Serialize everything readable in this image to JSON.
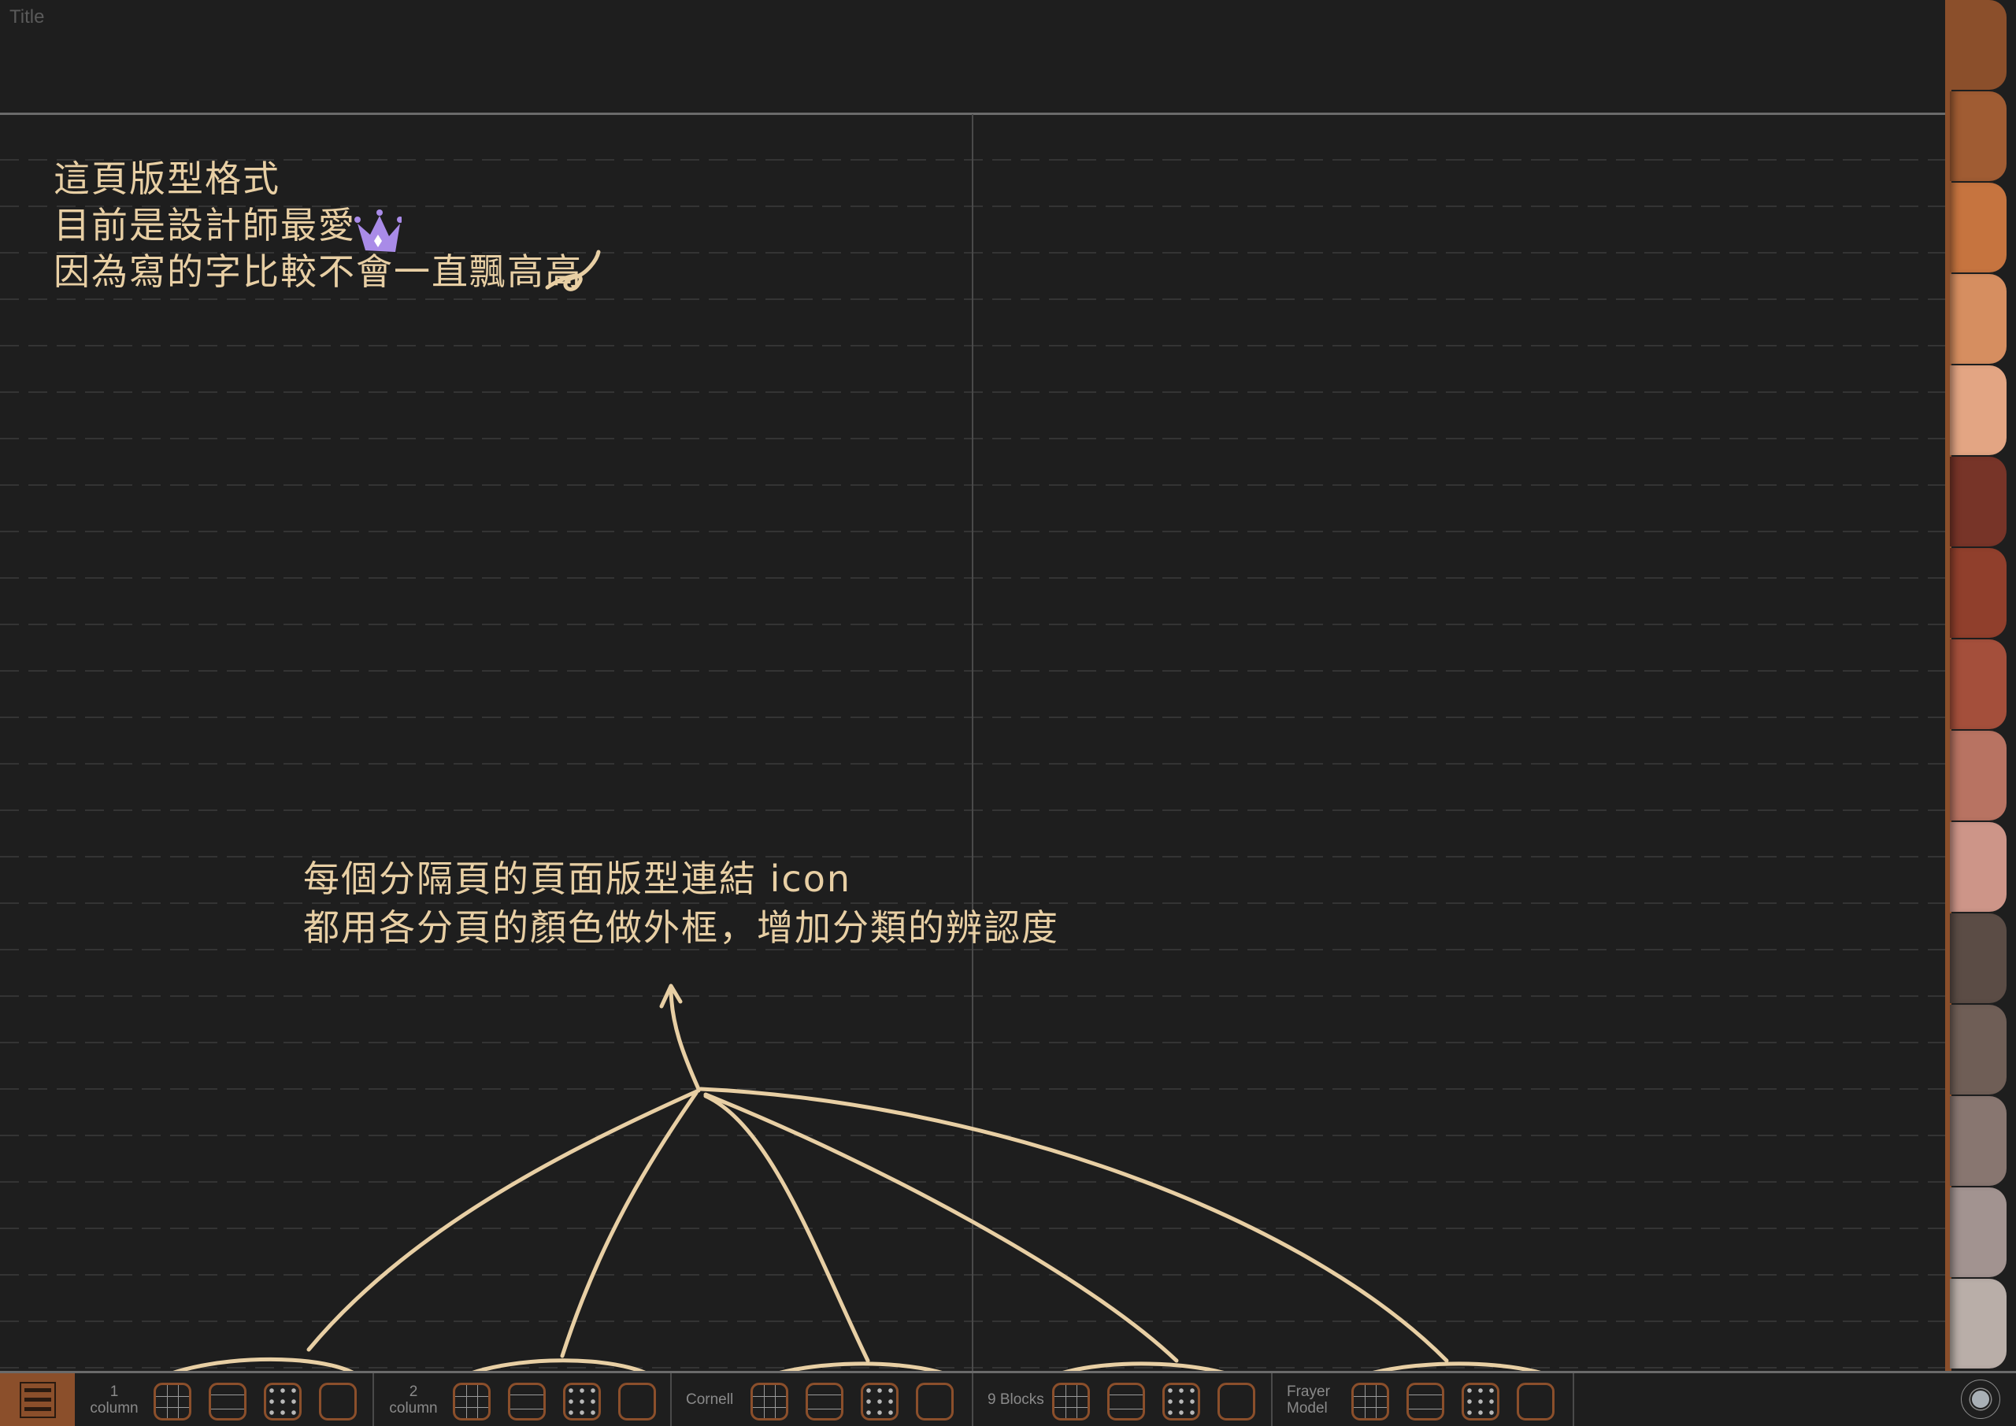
{
  "page": {
    "title_placeholder": "Title"
  },
  "notes": {
    "top_lines": [
      "這頁版型格式",
      "目前是設計師最愛",
      "因為寫的字比較不會一直飄高高"
    ],
    "bottom_lines": [
      "每個分隔頁的頁面版型連結 icon",
      "都用各分頁的顏色做外框，增加分類的辨認度"
    ],
    "ink_color": "#e8cfa4",
    "crown_color": "#a98be8"
  },
  "tabs": [
    {
      "color": "#8b4f2b",
      "active": true
    },
    {
      "color": "#a05c33"
    },
    {
      "color": "#c6743f"
    },
    {
      "color": "#d68e60"
    },
    {
      "color": "#e3a583"
    },
    {
      "color": "#773428"
    },
    {
      "color": "#903f2c"
    },
    {
      "color": "#a44f3b"
    },
    {
      "color": "#b87362"
    },
    {
      "color": "#cd9588"
    },
    {
      "color": "#5b4c45"
    },
    {
      "color": "#6f5e56"
    },
    {
      "color": "#887670"
    },
    {
      "color": "#a29390"
    },
    {
      "color": "#b9aea8"
    }
  ],
  "toolbar": {
    "menu_icon": "hamburger-menu-icon",
    "accent": "#8b4f2b",
    "sections": [
      {
        "label_lines": [
          "1",
          "column"
        ],
        "icons": [
          "grid",
          "lined",
          "dot",
          "blank"
        ]
      },
      {
        "label_lines": [
          "2",
          "column"
        ],
        "icons": [
          "grid",
          "lined",
          "dot",
          "blank"
        ]
      },
      {
        "label_lines": [
          "Cornell"
        ],
        "icons": [
          "grid",
          "lined",
          "dot",
          "blank"
        ]
      },
      {
        "label_lines": [
          "9 Blocks"
        ],
        "icons": [
          "grid",
          "lined",
          "dot",
          "blank"
        ]
      },
      {
        "label_lines": [
          "Frayer",
          "Model"
        ],
        "icons": [
          "grid",
          "lined",
          "dot",
          "blank"
        ]
      }
    ],
    "record_icon": "record-toggle-icon"
  }
}
